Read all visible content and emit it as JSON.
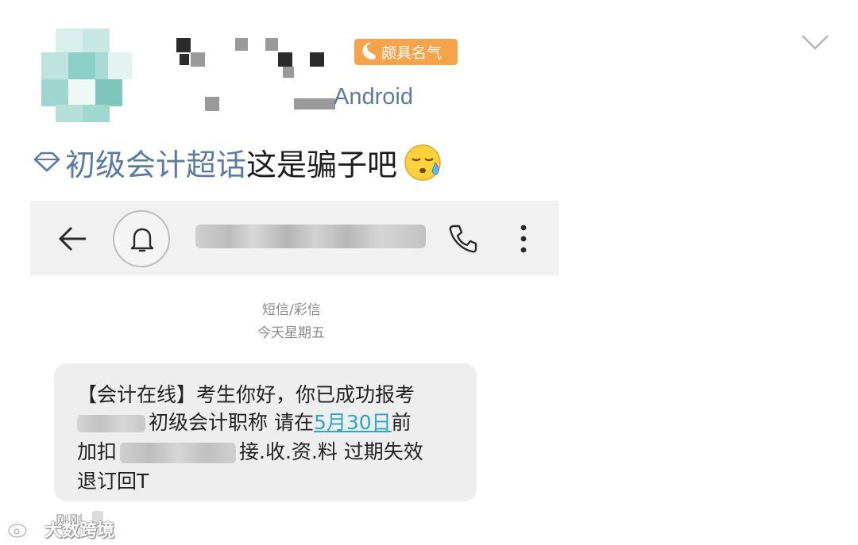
{
  "post": {
    "badge_label": "颇具名气",
    "device": "Android",
    "topic_label": "初级会计超话",
    "text": "这是骗子吧"
  },
  "sms_screen": {
    "meta_type": "短信/彩信",
    "meta_day": "今天星期五",
    "message": {
      "line1": "【会计在线】考生你好，你已成功报考",
      "line2_text": "初级会计职称 请在",
      "line2_date": "5月30日",
      "line2_tail": "前",
      "line3_head": "加扣",
      "line3_tail": "接.收.资.料 过期失效",
      "line4": "退订回T"
    },
    "time": "刚刚"
  },
  "watermark": {
    "text": "大数跨境"
  },
  "icons": [
    "avatar-pixelated",
    "pepper-icon",
    "chevron-down-icon",
    "topic-gem-icon",
    "sweat-emoji",
    "back-arrow-icon",
    "bell-icon",
    "phone-call-icon",
    "more-vert-icon",
    "weibo-logo-icon"
  ],
  "colors": {
    "topic_blue": "#5b7ba3",
    "badge_orange": "#f6a34a",
    "link_cyan": "#2ba6cc",
    "bubble_gray": "#eeeeee",
    "bar_gray": "#f1f1f1"
  }
}
